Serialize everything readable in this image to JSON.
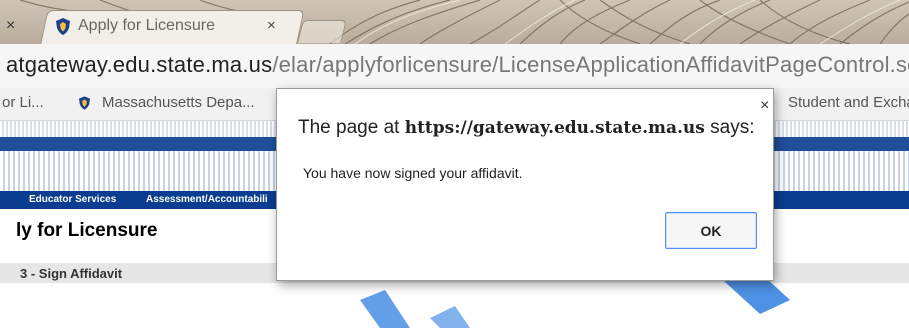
{
  "browser": {
    "tab": {
      "title": "Apply for Licensure",
      "close_glyph": "×"
    },
    "prev_tab_close_glyph": "×",
    "address": {
      "host": "atgateway.edu.state.ma.us",
      "path": "/elar/applyforlicensure/LicenseApplicationAffidavitPageControl.ser"
    },
    "bookmarks": [
      {
        "label": "or Li...",
        "icon": "none"
      },
      {
        "label": "Massachusetts Depa...",
        "icon": "shield-icon"
      },
      {
        "label": "Student and Excha",
        "icon": "none"
      }
    ]
  },
  "page": {
    "nav": [
      "Educator Services",
      "Assessment/Accountabili"
    ],
    "title": "ly for Licensure",
    "step": "3 - Sign Affidavit"
  },
  "dialog": {
    "heading_prefix": "The page at",
    "origin": "https://gateway.edu.state.ma.us",
    "heading_suffix": "says:",
    "message": "You have now signed your affidavit.",
    "ok_label": "OK",
    "close_glyph": "×"
  },
  "colors": {
    "nav_blue": "#0a3d8f",
    "header_blue": "#1f4e9b",
    "watermark_teal": "#33d6b4",
    "watermark_blue": "#2f7fe0"
  }
}
